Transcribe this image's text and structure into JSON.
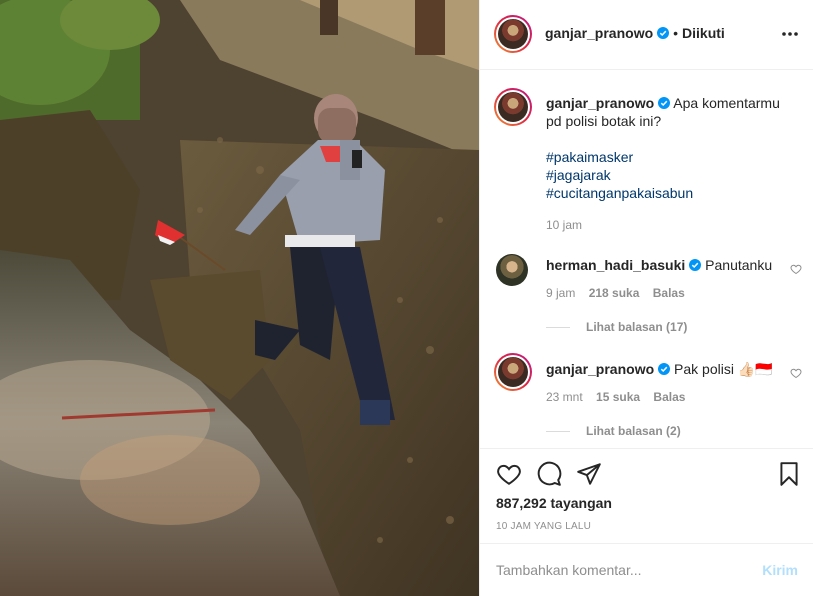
{
  "post": {
    "author": "ganjar_pranowo",
    "follow_status": "Diikuti",
    "follow_dot": "•",
    "more_icon": "more-horizontal-icon"
  },
  "caption": {
    "author": "ganjar_pranowo",
    "text": "Apa komentarmu pd polisi botak ini?",
    "hashtags": [
      "#pakaimasker",
      "#jagajarak",
      "#cucitanganpakaisabun"
    ],
    "time": "10 jam"
  },
  "comments": [
    {
      "author": "herman_hadi_basuki",
      "text": "Panutanku",
      "time": "9 jam",
      "likes": "218 suka",
      "reply": "Balas",
      "view_replies": "Lihat balasan (17)"
    },
    {
      "author": "ganjar_pranowo",
      "text": "Pak polisi 👍🏻🇮🇩",
      "time": "23 mnt",
      "likes": "15 suka",
      "reply": "Balas",
      "view_replies": "Lihat balasan (2)"
    }
  ],
  "stats": {
    "views": "887,292 tayangan",
    "posted": "10 JAM YANG LALU"
  },
  "composer": {
    "placeholder": "Tambahkan komentar...",
    "post_label": "Kirim"
  },
  "colors": {
    "link": "#00376b",
    "verified": "#0095f6",
    "muted": "#8e8e8e",
    "post_disabled": "#b2dffc"
  }
}
